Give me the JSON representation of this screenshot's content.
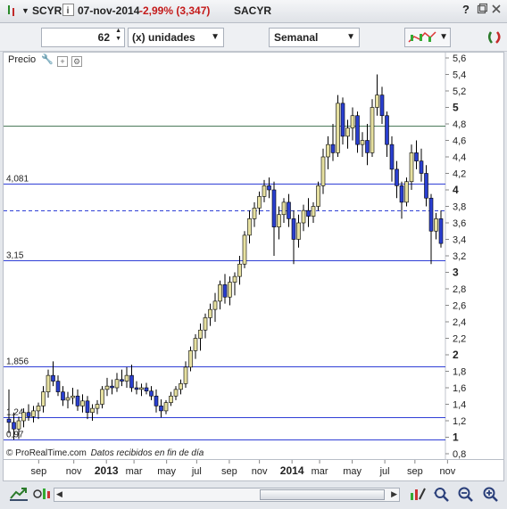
{
  "titlebar": {
    "symbol": "SCYR",
    "date": "07-nov-2014",
    "change": "-2,99% (3,347)",
    "name": "SACYR",
    "info_icon": "info-icon",
    "close_icon": "close-icon",
    "restore_icon": "restore-icon",
    "help_icon": "help-icon"
  },
  "toolbar": {
    "units_value": "62",
    "units_label": "(x) unidades",
    "period_value": "Semanal"
  },
  "chart": {
    "price_label": "Precio",
    "source_brand": "© ProRealTime.com",
    "source_text": "Datos recibidos en fin de día"
  },
  "colors": {
    "up_candle": "#e6e0a0",
    "down_candle": "#2a3fd0",
    "hline": "#2f3fd6",
    "hline_green": "#4a7a5a",
    "wick": "#000000"
  },
  "chart_data": {
    "type": "candlestick",
    "ylim": [
      0.8,
      5.6
    ],
    "y_ticks": [
      "5,6",
      "5,4",
      "5,2",
      "5",
      "4,8",
      "4,6",
      "4,4",
      "4,2",
      "4",
      "3,8",
      "3,6",
      "3,4",
      "3,2",
      "3",
      "2,8",
      "2,6",
      "2,4",
      "2,2",
      "2",
      "1,8",
      "1,6",
      "1,4",
      "1,2",
      "1",
      "0,8"
    ],
    "x_ticks": [
      "sep",
      "nov",
      "2013",
      "mar",
      "may",
      "jul",
      "sep",
      "nov",
      "2014",
      "mar",
      "may",
      "jul",
      "sep",
      "nov"
    ],
    "x_tick_pos": [
      0.07,
      0.14,
      0.205,
      0.26,
      0.325,
      0.385,
      0.45,
      0.51,
      0.575,
      0.63,
      0.695,
      0.76,
      0.82,
      0.885
    ],
    "hlines": [
      {
        "value": 4.775,
        "label": "",
        "style": "solid-green"
      },
      {
        "value": 4.081,
        "label": "4,081",
        "style": "solid"
      },
      {
        "value": 3.75,
        "label": "",
        "style": "dashed"
      },
      {
        "value": 3.15,
        "label": "3,15",
        "style": "solid"
      },
      {
        "value": 1.856,
        "label": "1,856",
        "style": "solid"
      },
      {
        "value": 1.24,
        "label": "1,24",
        "style": "solid"
      },
      {
        "value": 0.97,
        "label": "0,97",
        "style": "solid"
      }
    ],
    "ohlc": [
      [
        1.22,
        1.58,
        1.05,
        1.18
      ],
      [
        1.18,
        1.3,
        0.97,
        1.1
      ],
      [
        1.1,
        1.25,
        0.98,
        1.2
      ],
      [
        1.2,
        1.35,
        1.12,
        1.3
      ],
      [
        1.3,
        1.4,
        1.2,
        1.25
      ],
      [
        1.25,
        1.38,
        1.18,
        1.32
      ],
      [
        1.32,
        1.42,
        1.22,
        1.38
      ],
      [
        1.38,
        1.62,
        1.3,
        1.55
      ],
      [
        1.55,
        1.82,
        1.48,
        1.75
      ],
      [
        1.75,
        1.92,
        1.62,
        1.68
      ],
      [
        1.68,
        1.75,
        1.5,
        1.55
      ],
      [
        1.55,
        1.62,
        1.38,
        1.45
      ],
      [
        1.45,
        1.55,
        1.35,
        1.48
      ],
      [
        1.48,
        1.6,
        1.4,
        1.5
      ],
      [
        1.5,
        1.58,
        1.32,
        1.38
      ],
      [
        1.38,
        1.52,
        1.3,
        1.44
      ],
      [
        1.44,
        1.5,
        1.22,
        1.3
      ],
      [
        1.3,
        1.4,
        1.2,
        1.35
      ],
      [
        1.35,
        1.45,
        1.28,
        1.4
      ],
      [
        1.4,
        1.62,
        1.35,
        1.58
      ],
      [
        1.58,
        1.72,
        1.5,
        1.62
      ],
      [
        1.62,
        1.7,
        1.52,
        1.6
      ],
      [
        1.6,
        1.78,
        1.55,
        1.7
      ],
      [
        1.7,
        1.82,
        1.62,
        1.68
      ],
      [
        1.68,
        1.85,
        1.6,
        1.75
      ],
      [
        1.75,
        1.88,
        1.55,
        1.6
      ],
      [
        1.6,
        1.68,
        1.52,
        1.58
      ],
      [
        1.58,
        1.65,
        1.5,
        1.6
      ],
      [
        1.6,
        1.66,
        1.52,
        1.56
      ],
      [
        1.56,
        1.62,
        1.45,
        1.5
      ],
      [
        1.5,
        1.58,
        1.3,
        1.38
      ],
      [
        1.38,
        1.46,
        1.24,
        1.32
      ],
      [
        1.32,
        1.45,
        1.28,
        1.42
      ],
      [
        1.42,
        1.55,
        1.38,
        1.5
      ],
      [
        1.5,
        1.62,
        1.45,
        1.58
      ],
      [
        1.58,
        1.7,
        1.52,
        1.65
      ],
      [
        1.65,
        1.92,
        1.6,
        1.85
      ],
      [
        1.85,
        2.1,
        1.8,
        2.05
      ],
      [
        2.05,
        2.25,
        1.95,
        2.2
      ],
      [
        2.2,
        2.38,
        2.05,
        2.3
      ],
      [
        2.3,
        2.5,
        2.2,
        2.45
      ],
      [
        2.45,
        2.62,
        2.35,
        2.55
      ],
      [
        2.55,
        2.75,
        2.4,
        2.65
      ],
      [
        2.65,
        2.9,
        2.55,
        2.85
      ],
      [
        2.85,
        2.98,
        2.62,
        2.7
      ],
      [
        2.7,
        2.95,
        2.6,
        2.88
      ],
      [
        2.88,
        3.0,
        2.72,
        2.95
      ],
      [
        2.95,
        3.2,
        2.85,
        3.1
      ],
      [
        3.1,
        3.5,
        3.05,
        3.45
      ],
      [
        3.45,
        3.75,
        3.35,
        3.65
      ],
      [
        3.65,
        3.85,
        3.55,
        3.78
      ],
      [
        3.78,
        3.98,
        3.7,
        3.92
      ],
      [
        3.92,
        4.12,
        3.85,
        4.05
      ],
      [
        4.05,
        4.15,
        3.9,
        4.0
      ],
      [
        4.0,
        4.1,
        3.2,
        3.55
      ],
      [
        3.55,
        3.8,
        3.4,
        3.7
      ],
      [
        3.7,
        3.9,
        3.6,
        3.85
      ],
      [
        3.85,
        3.95,
        3.55,
        3.65
      ],
      [
        3.65,
        3.75,
        3.1,
        3.4
      ],
      [
        3.4,
        3.7,
        3.3,
        3.6
      ],
      [
        3.6,
        3.82,
        3.5,
        3.75
      ],
      [
        3.75,
        3.9,
        3.55,
        3.68
      ],
      [
        3.68,
        3.85,
        3.6,
        3.8
      ],
      [
        3.8,
        4.1,
        3.75,
        4.05
      ],
      [
        4.05,
        4.5,
        3.95,
        4.4
      ],
      [
        4.4,
        4.65,
        4.25,
        4.55
      ],
      [
        4.55,
        4.8,
        4.35,
        4.45
      ],
      [
        4.45,
        5.15,
        4.4,
        5.05
      ],
      [
        5.05,
        5.12,
        4.55,
        4.65
      ],
      [
        4.65,
        4.85,
        4.5,
        4.75
      ],
      [
        4.75,
        5.0,
        4.6,
        4.9
      ],
      [
        4.9,
        4.95,
        4.45,
        4.55
      ],
      [
        4.55,
        4.7,
        4.4,
        4.6
      ],
      [
        4.6,
        4.8,
        4.3,
        4.45
      ],
      [
        4.45,
        5.1,
        4.4,
        5.0
      ],
      [
        5.0,
        5.4,
        4.9,
        5.15
      ],
      [
        5.15,
        5.25,
        4.8,
        4.9
      ],
      [
        4.9,
        4.95,
        4.4,
        4.55
      ],
      [
        4.55,
        4.65,
        4.1,
        4.25
      ],
      [
        4.25,
        4.35,
        3.9,
        4.05
      ],
      [
        4.05,
        4.1,
        3.65,
        3.85
      ],
      [
        3.85,
        4.15,
        3.8,
        4.1
      ],
      [
        4.1,
        4.55,
        4.0,
        4.45
      ],
      [
        4.45,
        4.6,
        4.25,
        4.35
      ],
      [
        4.35,
        4.5,
        4.1,
        4.2
      ],
      [
        4.2,
        4.3,
        3.8,
        3.9
      ],
      [
        3.9,
        3.95,
        3.1,
        3.5
      ],
      [
        3.5,
        3.72,
        3.4,
        3.65
      ],
      [
        3.65,
        3.75,
        3.3,
        3.35
      ]
    ]
  },
  "bottombar": {
    "icons": [
      "chart-add-icon",
      "indicators-icon",
      "scroll-left-icon",
      "scroll-right-icon",
      "draw-icon",
      "zoom-fit-icon",
      "zoom-out-icon",
      "zoom-in-icon"
    ]
  }
}
